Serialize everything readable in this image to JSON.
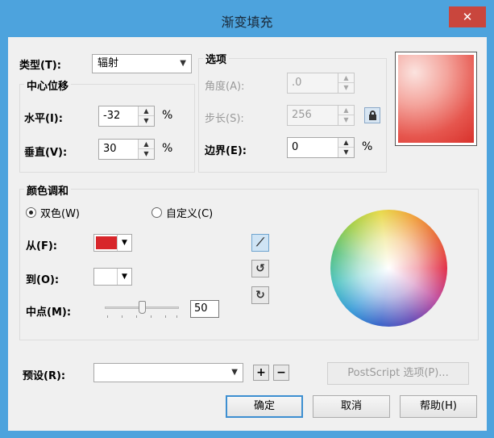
{
  "window": {
    "title": "渐变填充",
    "close": "✕"
  },
  "type": {
    "label": "类型(T):",
    "value": "辐射"
  },
  "center": {
    "group": "中心位移",
    "horizontal_label": "水平(I):",
    "horizontal_value": "-32",
    "horizontal_unit": "%",
    "vertical_label": "垂直(V):",
    "vertical_value": "30",
    "vertical_unit": "%"
  },
  "options": {
    "group": "选项",
    "angle_label": "角度(A):",
    "angle_value": ".0",
    "steps_label": "步长(S):",
    "steps_value": "256",
    "edge_label": "边界(E):",
    "edge_value": "0",
    "edge_unit": "%"
  },
  "blend": {
    "group": "颜色调和",
    "two_color": "双色(W)",
    "custom": "自定义(C)",
    "from_label": "从(F):",
    "from_color": "#d8262b",
    "to_label": "到(O):",
    "to_color": "#ffffff",
    "mid_label": "中点(M):",
    "mid_value": "50",
    "mid_fraction": 0.5
  },
  "preset": {
    "label": "预设(R):",
    "value": "",
    "add": "+",
    "remove": "−",
    "postscript": "PostScript 选项(P)..."
  },
  "buttons": {
    "ok": "确定",
    "cancel": "取消",
    "help": "帮助(H)"
  },
  "icons": {
    "line": "line-blend-icon",
    "ccw": "counterclockwise-blend-icon",
    "cw": "clockwise-blend-icon"
  }
}
